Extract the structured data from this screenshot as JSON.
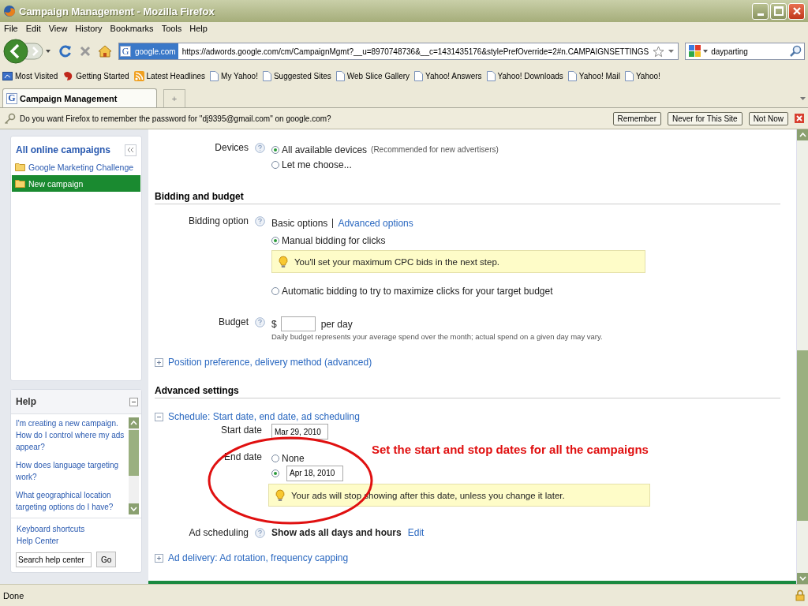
{
  "window": {
    "title": "Campaign Management - Mozilla Firefox"
  },
  "menu": [
    "File",
    "Edit",
    "View",
    "History",
    "Bookmarks",
    "Tools",
    "Help"
  ],
  "navigation": {
    "favicon": "G",
    "identity": "google.com",
    "url": "https://adwords.google.com/cm/CampaignMgmt?__u=8970748736&__c=1431435176&stylePrefOverride=2#n.CAMPAIGNSETTINGS",
    "search_value": "dayparting"
  },
  "bookmarks": [
    {
      "label": "Most Visited",
      "kind": "smart"
    },
    {
      "label": "Getting Started",
      "kind": "start"
    },
    {
      "label": "Latest Headlines",
      "kind": "feed"
    },
    {
      "label": "My Yahoo!",
      "kind": "page"
    },
    {
      "label": "Suggested Sites",
      "kind": "page"
    },
    {
      "label": "Web Slice Gallery",
      "kind": "page"
    },
    {
      "label": "Yahoo! Answers",
      "kind": "page"
    },
    {
      "label": "Yahoo! Downloads",
      "kind": "page"
    },
    {
      "label": "Yahoo! Mail",
      "kind": "page"
    },
    {
      "label": "Yahoo!",
      "kind": "page"
    }
  ],
  "tabs": [
    {
      "favicon": "G",
      "label": "Campaign Management",
      "selected": true
    }
  ],
  "new_tab": "+",
  "notification": {
    "message": "Do you want Firefox to remember the password for \"dj9395@gmail.com\" on google.com?",
    "buttons": [
      "Remember",
      "Never for This Site",
      "Not Now"
    ]
  },
  "sidebar": {
    "title": "All online campaigns",
    "campaigns": [
      {
        "label": "Google Marketing Challenge",
        "selected": false
      },
      {
        "label": "New campaign",
        "selected": true
      }
    ]
  },
  "help": {
    "title": "Help",
    "expanded": true,
    "links": [
      "I'm creating a new campaign. How do I control where my ads appear?",
      "How does language targeting work?",
      "What geographical location targeting options do I have?"
    ],
    "footer_links": [
      "Keyboard shortcuts",
      "Help Center"
    ],
    "search_placeholder": "Search help center",
    "go": "Go"
  },
  "form": {
    "devices": {
      "label": "Devices",
      "options": [
        {
          "label": "All available devices",
          "note": "(Recommended for new advertisers)",
          "selected": true
        },
        {
          "label": "Let me choose...",
          "selected": false
        }
      ]
    },
    "bidding_section": "Bidding and budget",
    "bidding": {
      "label": "Bidding option",
      "mode_current": "Basic options",
      "mode_link": "Advanced options",
      "options": [
        {
          "label": "Manual bidding for clicks",
          "selected": true,
          "tip": "You'll set your maximum CPC bids in the next step."
        },
        {
          "label": "Automatic bidding to try to maximize clicks for your target budget",
          "selected": false
        }
      ]
    },
    "budget": {
      "label": "Budget",
      "currency": "$",
      "unit": "per day",
      "hint": "Daily budget represents your average spend over the month; actual spend on a given day may vary."
    },
    "position_link": {
      "label": "Position preference, delivery method (advanced)",
      "expanded": false
    },
    "advanced_section": "Advanced settings",
    "schedule": {
      "label": "Schedule: Start date, end date, ad scheduling",
      "expanded": true,
      "start_label": "Start date",
      "start_value": "Mar 29, 2010",
      "end_label": "End date",
      "end_options": [
        {
          "label": "None",
          "selected": false
        },
        {
          "value": "Apr 18, 2010",
          "selected": true
        }
      ],
      "tip": "Your ads will stop showing after this date, unless you change it later.",
      "ad_scheduling_label": "Ad scheduling",
      "ad_scheduling_value": "Show ads all days and hours",
      "edit": "Edit"
    },
    "delivery_link": {
      "label": "Ad delivery: Ad rotation, frequency capping",
      "expanded": false
    }
  },
  "annotation": {
    "text": "Set the start and stop dates for all the campaigns"
  },
  "status_bar": {
    "text": "Done"
  }
}
